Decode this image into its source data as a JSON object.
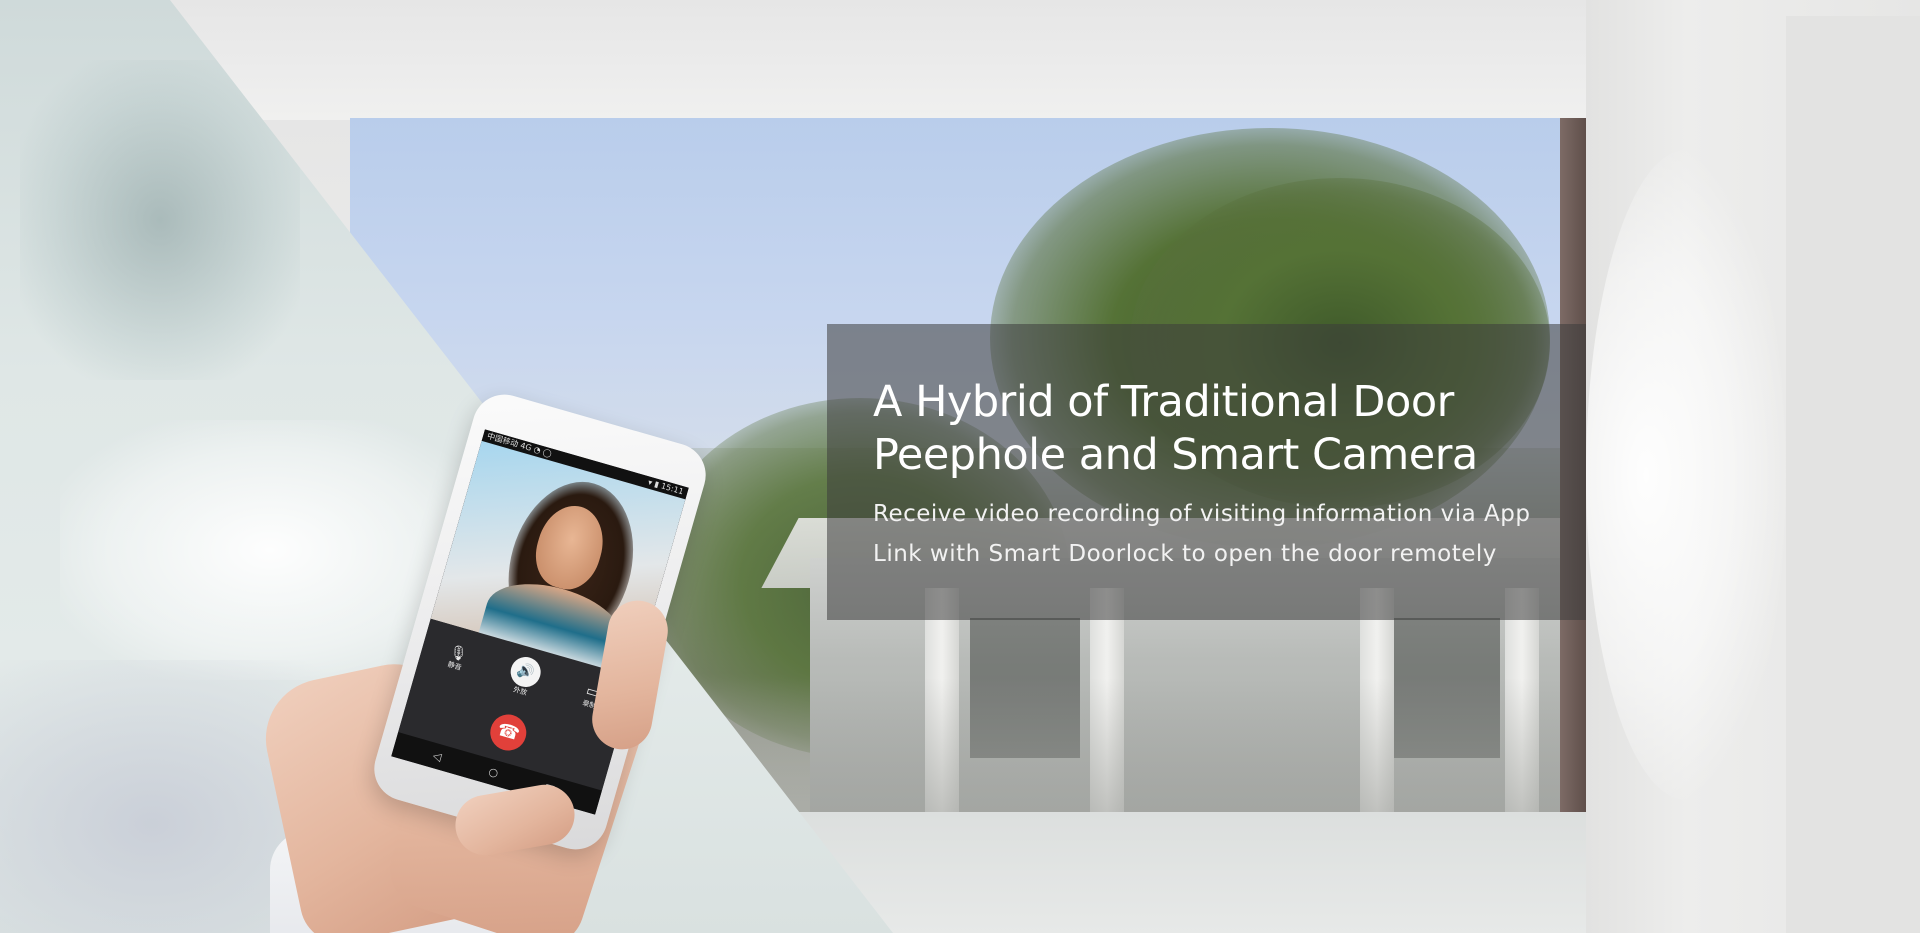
{
  "hero": {
    "headline_line1": "A Hybrid of Traditional Door",
    "headline_line2": "Peephole and Smart Camera",
    "feature_1": "Receive video recording of visiting information via App",
    "feature_2": "Link with Smart Doorlock to open the door remotely"
  },
  "phone_screen": {
    "status_left": "中国移动 4G ◔ ◯",
    "status_right": "▾ ▮ 15:11",
    "mute_label": "静音",
    "speaker_label": "外放",
    "record_label": "录制",
    "icons": [
      "microphone-icon",
      "speaker-icon",
      "video-record-icon",
      "hang-up-icon",
      "back-icon",
      "home-icon",
      "recent-apps-icon"
    ]
  },
  "colors": {
    "overlay": "rgba(60,60,60,0.55)",
    "headline": "#ffffff",
    "hangup": "#e1403a"
  }
}
